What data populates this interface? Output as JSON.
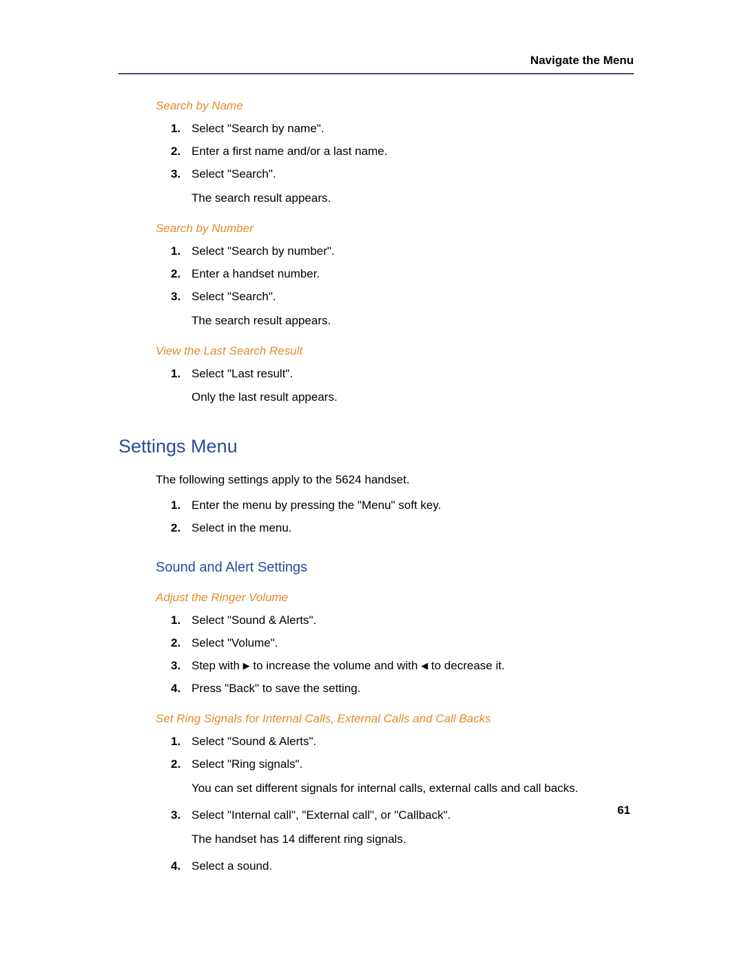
{
  "header": "Navigate the Menu",
  "page_number": "61",
  "sec1": {
    "title": "Search by Name",
    "steps": [
      {
        "n": "1.",
        "t": "Select \"Search by name\"."
      },
      {
        "n": "2.",
        "t": "Enter a first name and/or a last name."
      },
      {
        "n": "3.",
        "t": "Select \"Search\"."
      }
    ],
    "result": "The search result appears."
  },
  "sec2": {
    "title": "Search by Number",
    "steps": [
      {
        "n": "1.",
        "t": "Select \"Search by number\"."
      },
      {
        "n": "2.",
        "t": "Enter a handset number."
      },
      {
        "n": "3.",
        "t": "Select \"Search\"."
      }
    ],
    "result": "The search result appears."
  },
  "sec3": {
    "title": "View the Last Search Result",
    "steps": [
      {
        "n": "1.",
        "t": "Select \"Last result\"."
      }
    ],
    "result": "Only the last result appears."
  },
  "settings": {
    "h1": "Settings Menu",
    "intro": "The following settings apply to the 5624 handset.",
    "steps": [
      {
        "n": "1.",
        "t": "Enter the menu by pressing the \"Menu\" soft key."
      },
      {
        "n": "2.",
        "t": "Select       in the menu."
      }
    ]
  },
  "sound": {
    "h2": "Sound and Alert Settings",
    "sub1": {
      "title": "Adjust the Ringer Volume",
      "steps": [
        {
          "n": "1.",
          "t": "Select \"Sound & Alerts\"."
        },
        {
          "n": "2.",
          "t": "Select \"Volume\"."
        },
        {
          "n": "3.",
          "pre": "Step with ",
          "mid": " to increase the volume and with ",
          "post": " to decrease it."
        },
        {
          "n": "4.",
          "t": "Press \"Back\" to save the setting."
        }
      ]
    },
    "sub2": {
      "title": "Set Ring Signals for Internal Calls, External Calls and Call Backs",
      "steps": [
        {
          "n": "1.",
          "t": "Select \"Sound & Alerts\"."
        },
        {
          "n": "2.",
          "t": "Select \"Ring signals\"."
        }
      ],
      "note1": "You can set different signals for internal calls, external calls and call backs.",
      "steps2": [
        {
          "n": "3.",
          "t": "Select \"Internal call\", \"External call\", or \"Callback\"."
        }
      ],
      "note2": "The handset has 14 different ring signals.",
      "steps3": [
        {
          "n": "4.",
          "t": "Select a sound."
        }
      ]
    }
  },
  "arrows": {
    "right": "▶",
    "left": "◀"
  }
}
